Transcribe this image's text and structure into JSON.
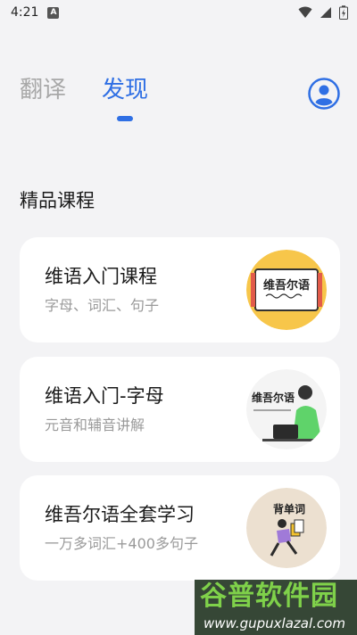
{
  "status_bar": {
    "time": "4:21",
    "notification_letter": "A"
  },
  "tabs": [
    {
      "label": "翻译",
      "active": false
    },
    {
      "label": "发现",
      "active": true
    }
  ],
  "section_title": "精品课程",
  "courses": [
    {
      "title": "维语入门课程",
      "subtitle": "字母、词汇、句子",
      "thumb_text": "维吾尔语"
    },
    {
      "title": "维语入门-字母",
      "subtitle": "元音和辅音讲解",
      "thumb_text": "维吾尔语"
    },
    {
      "title": "维吾尔语全套学习",
      "subtitle": "一万多词汇+400多句子",
      "thumb_text": "背单词"
    }
  ],
  "watermark": {
    "big": "谷普软件园",
    "small": "www.gupuxlazal.com"
  },
  "colors": {
    "accent": "#2f6fe4",
    "background": "#f3f3f5",
    "card": "#ffffff"
  }
}
